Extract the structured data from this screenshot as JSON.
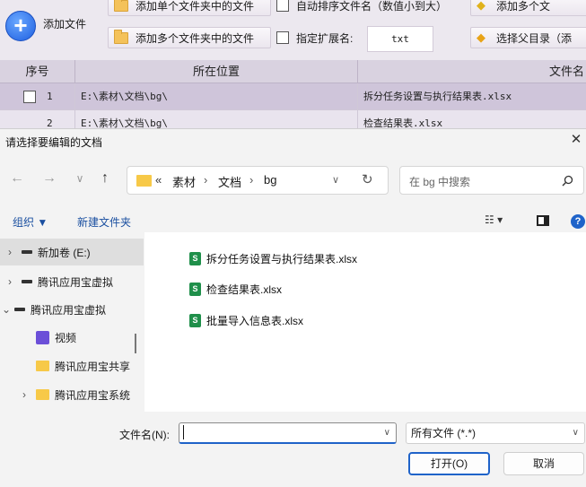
{
  "app": {
    "add_file_label": "添加文件",
    "toolbar_row1": {
      "add_single_folder": "添加单个文件夹中的文件",
      "auto_sort": "自动排序文件名（数值小到大）",
      "add_multi_right": "添加多个文"
    },
    "toolbar_row2": {
      "add_multi_folder": "添加多个文件夹中的文件",
      "ext_label": "指定扩展名:",
      "ext_value": "txt",
      "select_parent": "选择父目录（添"
    },
    "table": {
      "headers": [
        "序号",
        "所在位置",
        "文件名"
      ],
      "rows": [
        {
          "index": "1",
          "location": "E:\\素材\\文档\\bg\\",
          "filename": "拆分任务设置与执行结果表.xlsx"
        },
        {
          "index": "2",
          "location": "E:\\素材\\文档\\bg\\",
          "filename": "检查结果表.xlsx"
        }
      ]
    }
  },
  "dialog": {
    "title": "请选择要编辑的文档",
    "close": "✕",
    "nav": {
      "back": "←",
      "forward": "→",
      "recent": "∨",
      "up": "↑",
      "refresh": "↻"
    },
    "breadcrumb": {
      "prefix": "«",
      "parts": [
        "素材",
        "文档",
        "bg"
      ],
      "sep": "›"
    },
    "search_placeholder": "在 bg 中搜索",
    "commands": {
      "organize": "组织 ▼",
      "new_folder": "新建文件夹"
    },
    "nav_pane": [
      {
        "chevron": "›",
        "icon": "drive",
        "label": "新加卷 (E:)"
      },
      {
        "chevron": "›",
        "icon": "drive",
        "label": "腾讯应用宝虚拟"
      },
      {
        "chevron": "⌄",
        "icon": "drive",
        "label": "腾讯应用宝虚拟"
      },
      {
        "chevron": "",
        "icon": "video",
        "label": "视频"
      },
      {
        "chevron": "",
        "icon": "folder",
        "label": "腾讯应用宝共享"
      },
      {
        "chevron": "›",
        "icon": "folder",
        "label": "腾讯应用宝系统"
      }
    ],
    "files": [
      "拆分任务设置与执行结果表.xlsx",
      "检查结果表.xlsx",
      "批量导入信息表.xlsx"
    ],
    "filename_label": "文件名(N):",
    "filename_value": "",
    "filetype": "所有文件 (*.*)",
    "open_button": "打开(O)",
    "cancel_button": "取消"
  }
}
